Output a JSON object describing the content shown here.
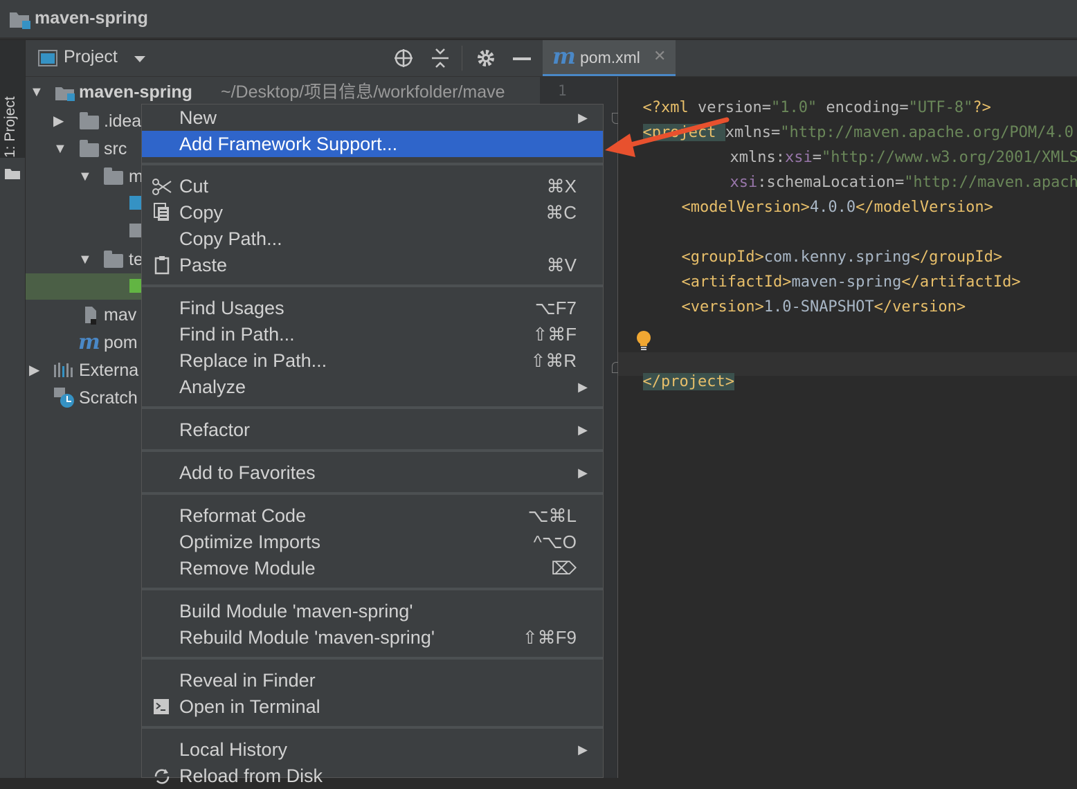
{
  "window": {
    "title": "maven-spring"
  },
  "tool_stripe": {
    "label": "1: Project"
  },
  "project_panel": {
    "view_label": "Project",
    "tree": [
      {
        "label": "maven-spring",
        "path": "~/Desktop/项目信息/workfolder/mave"
      },
      {
        "label": ".idea"
      },
      {
        "label": "src"
      },
      {
        "label": "m"
      },
      {
        "label": "te"
      },
      {
        "label": "mav"
      },
      {
        "label": "pom"
      },
      {
        "label": "Externa"
      },
      {
        "label": "Scratch"
      }
    ]
  },
  "editor": {
    "tab_label": "pom.xml",
    "line_number": "1",
    "lines": [
      {
        "a": "<?xml ",
        "b": "version",
        "c": "=",
        "d": "\"1.0\"",
        "e": " encoding",
        "f": "=",
        "g": "\"UTF-8\"",
        "h": "?>"
      },
      {
        "a": "<project ",
        "b": "xmlns",
        "c": "=",
        "d": "\"http://maven.apache.org/POM/4.0"
      },
      {
        "a": "xmlns:",
        "b": "xsi",
        "c": "=",
        "d": "\"http://www.w3.org/2001/XMLS"
      },
      {
        "a": "xsi",
        "b": ":schemaLocation",
        "c": "=",
        "d": "\"http://maven.apach"
      },
      {
        "open": "<modelVersion>",
        "val": "4.0.0",
        "close": "</modelVersion>"
      },
      {
        "open": "<groupId>",
        "val": "com.kenny.spring",
        "close": "</groupId>"
      },
      {
        "open": "<artifactId>",
        "val": "maven-spring",
        "close": "</artifactId>"
      },
      {
        "open": "<version>",
        "val": "1.0-SNAPSHOT",
        "close": "</version>"
      },
      {
        "close_project": "</project>"
      }
    ]
  },
  "context_menu": {
    "items": [
      {
        "label": "New",
        "submenu": true
      },
      {
        "label": "Add Framework Support...",
        "highlighted": true
      },
      {
        "label": "Cut",
        "shortcut": "⌘X",
        "icon": "scissors-icon"
      },
      {
        "label": "Copy",
        "shortcut": "⌘C",
        "icon": "copy-icon"
      },
      {
        "label": "Copy Path..."
      },
      {
        "label": "Paste",
        "shortcut": "⌘V",
        "icon": "clipboard-icon"
      },
      {
        "label": "Find Usages",
        "shortcut": "⌥F7"
      },
      {
        "label": "Find in Path...",
        "shortcut": "⇧⌘F"
      },
      {
        "label": "Replace in Path...",
        "shortcut": "⇧⌘R"
      },
      {
        "label": "Analyze",
        "submenu": true
      },
      {
        "label": "Refactor",
        "submenu": true
      },
      {
        "label": "Add to Favorites",
        "submenu": true
      },
      {
        "label": "Reformat Code",
        "shortcut": "⌥⌘L"
      },
      {
        "label": "Optimize Imports",
        "shortcut": "^⌥O"
      },
      {
        "label": "Remove Module",
        "shortcut": "⌦"
      },
      {
        "label": "Build Module 'maven-spring'"
      },
      {
        "label": "Rebuild Module 'maven-spring'",
        "shortcut": "⇧⌘F9"
      },
      {
        "label": "Reveal in Finder"
      },
      {
        "label": "Open in Terminal",
        "icon": "terminal-icon"
      },
      {
        "label": "Local History",
        "submenu": true
      },
      {
        "label": "Reload from Disk",
        "icon": "reload-icon"
      }
    ]
  },
  "colors": {
    "menu_highlight": "#2f65ca",
    "annotation_arrow": "#e8512e",
    "xml_tag": "#e8bf6a",
    "xml_value": "#6a8759"
  }
}
